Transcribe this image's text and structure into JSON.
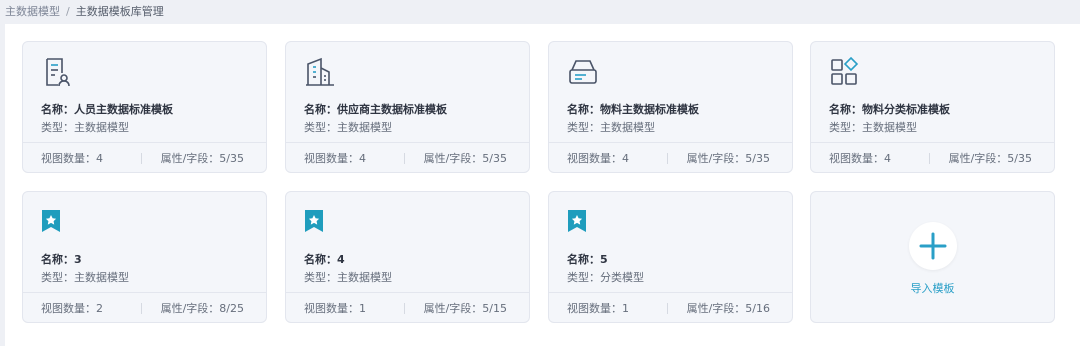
{
  "breadcrumb": {
    "items": [
      "主数据模型",
      "主数据模板库管理"
    ],
    "separator": "/"
  },
  "colors": {
    "accent": "#2a9fc7",
    "icon_stroke": "#4a5468",
    "bookmark": "#1f9dbd"
  },
  "cards": [
    {
      "icon": "person-document-icon",
      "name": "名称：人员主数据标准模板",
      "type": "类型：主数据模型",
      "views": "视图数量：4",
      "attrs": "属性/字段：5/35"
    },
    {
      "icon": "building-icon",
      "name": "名称：供应商主数据标准模板",
      "type": "类型：主数据模型",
      "views": "视图数量：4",
      "attrs": "属性/字段：5/35"
    },
    {
      "icon": "inbox-tray-icon",
      "name": "名称：物料主数据标准模板",
      "type": "类型：主数据模型",
      "views": "视图数量：4",
      "attrs": "属性/字段：5/35"
    },
    {
      "icon": "category-grid-icon",
      "name": "名称：物料分类标准模板",
      "type": "类型：主数据模型",
      "views": "视图数量：4",
      "attrs": "属性/字段：5/35"
    },
    {
      "icon": "bookmark-star-icon",
      "name": "名称：3",
      "type": "类型：主数据模型",
      "views": "视图数量：2",
      "attrs": "属性/字段：8/25"
    },
    {
      "icon": "bookmark-star-icon",
      "name": "名称：4",
      "type": "类型：主数据模型",
      "views": "视图数量：1",
      "attrs": "属性/字段：5/15"
    },
    {
      "icon": "bookmark-star-icon",
      "name": "名称：5",
      "type": "类型：分类模型",
      "views": "视图数量：1",
      "attrs": "属性/字段：5/16"
    }
  ],
  "import_card": {
    "icon": "plus-icon",
    "label": "导入模板"
  }
}
